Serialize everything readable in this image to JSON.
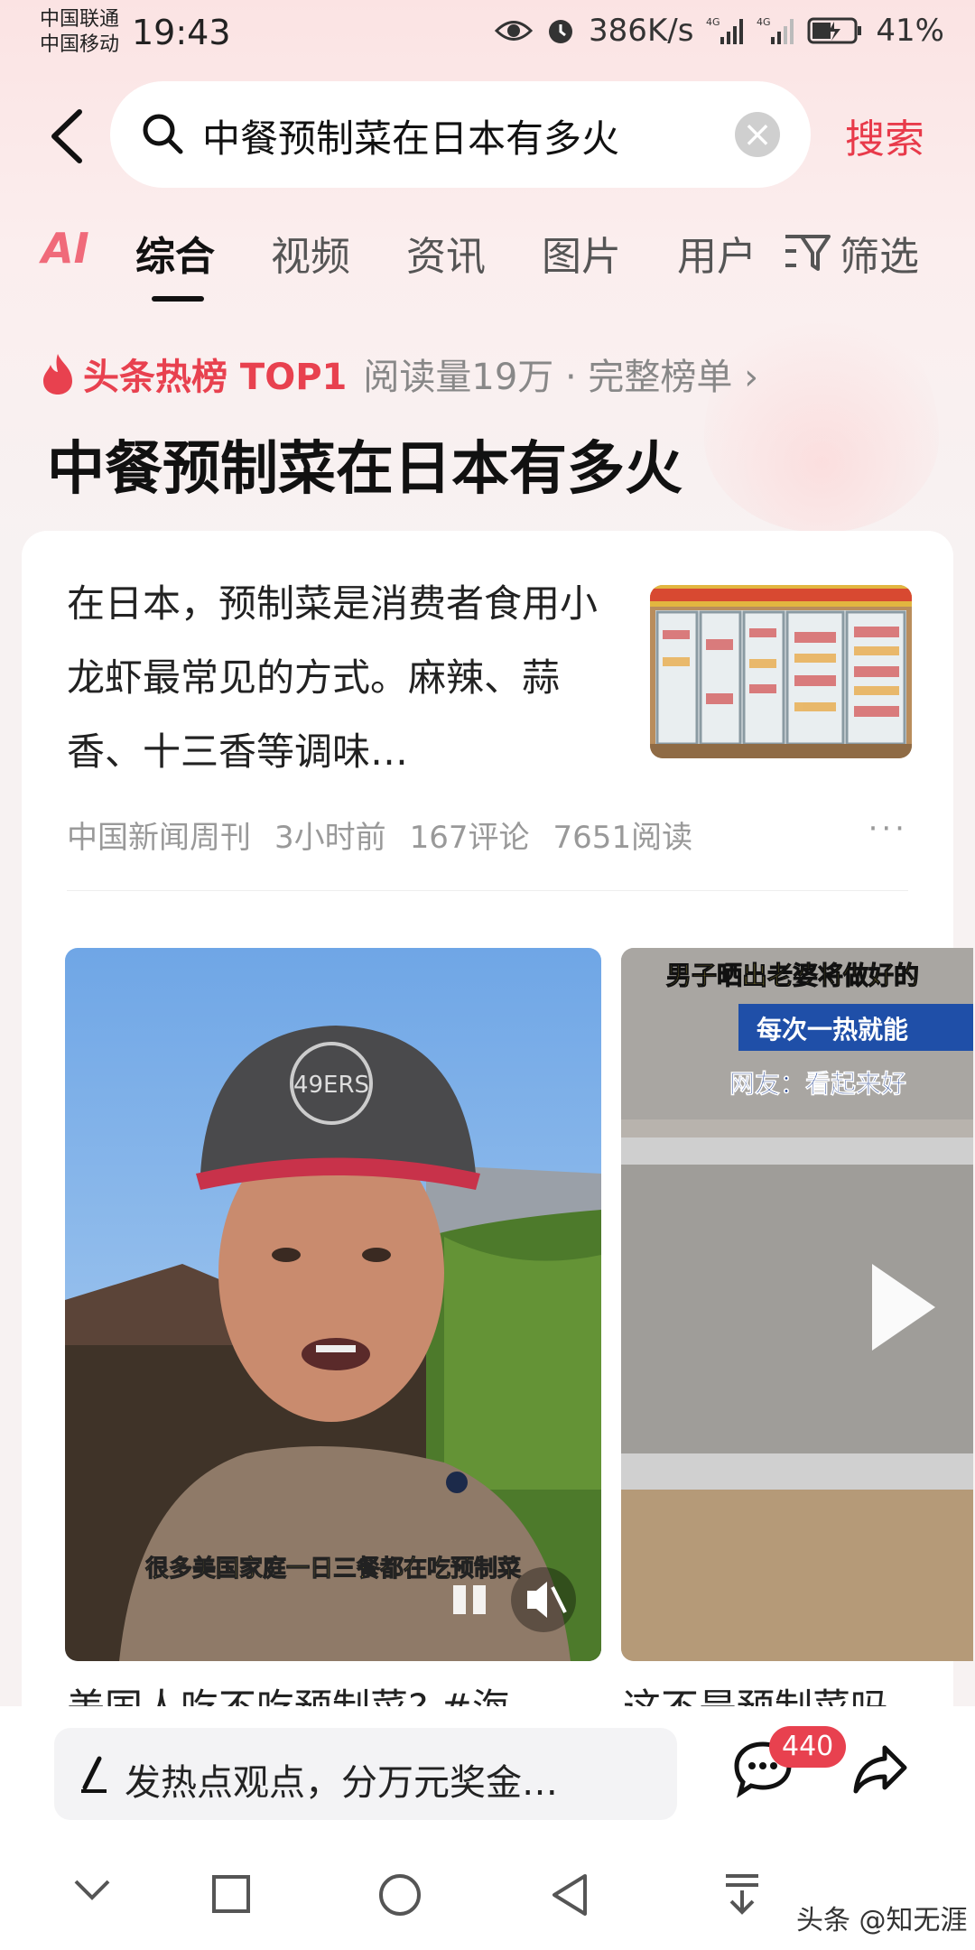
{
  "status_bar": {
    "carrier_1": "中国联通",
    "carrier_2": "中国移动",
    "time": "19:43",
    "net_speed": "386K/s",
    "signal_1": "4G",
    "signal_2": "4G",
    "battery": "41%"
  },
  "search": {
    "query": "中餐预制菜在日本有多火",
    "button": "搜索"
  },
  "tabs": [
    "AI",
    "综合",
    "视频",
    "资讯",
    "图片",
    "用户"
  ],
  "active_tab": "综合",
  "filter_label": "筛选",
  "hot": {
    "label": "头条热榜 TOP1",
    "meta": "阅读量19万 · 完整榜单 ›"
  },
  "topic_title": "中餐预制菜在日本有多火",
  "article": {
    "text": "在日本，预制菜是消费者食用小龙虾最常见的方式。麻辣、蒜香、十三香等调味…",
    "source": "中国新闻周刊",
    "time": "3小时前",
    "comments": "167评论",
    "reads": "7651阅读",
    "more": "···"
  },
  "video1": {
    "caption": "很多美国家庭一日三餐都在吃预制菜",
    "cap_logo": "49ERS",
    "title": "美国人吃不吃预制菜?  #海"
  },
  "video2": {
    "banner_1": "男子晒出老婆将做好的",
    "banner_2": "每次一热就能",
    "banner_3": "网友：看起来好",
    "title": "这不是预制菜吗"
  },
  "comment_bar": {
    "placeholder": "发热点观点，分万元奖金…",
    "count": "440"
  },
  "watermark": "头条 @知无涯",
  "colors": {
    "accent": "#e8414f",
    "background": "#f7f2f2"
  }
}
